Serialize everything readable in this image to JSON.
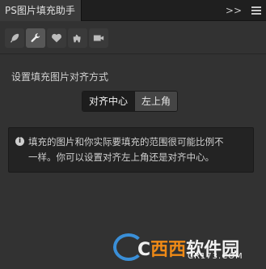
{
  "window": {
    "title": "PS图片填充助手"
  },
  "titlebar_controls": {
    "collapse_label": ">>",
    "menu_icon": "hamburger-menu-icon"
  },
  "tool_tabs": [
    {
      "icon": "feather-icon",
      "active": false
    },
    {
      "icon": "wrench-icon",
      "active": true
    },
    {
      "icon": "heart-icon",
      "active": false
    },
    {
      "icon": "dog-icon",
      "active": false
    },
    {
      "icon": "video-camera-icon",
      "active": false
    }
  ],
  "settings": {
    "section_label": "设置填充图片对齐方式",
    "align_options": [
      "对齐中心",
      "左上角"
    ],
    "selected": "对齐中心"
  },
  "info": {
    "line1": "填充的图片和你实际要填充的范围很可能比例不",
    "line2": "一样。你可以设置对齐左上角还是对齐中心。"
  },
  "watermark": {
    "main_prefix": "C",
    "main_highlight": "西西",
    "main_suffix": "软件园",
    "sub": "CR173.COM"
  },
  "colors": {
    "panel_bg": "#323232",
    "titlebar_bg": "#1f1f1f",
    "info_bg": "#232323",
    "brand_orange": "#f08a16",
    "brand_blue": "#3a8fd8"
  }
}
